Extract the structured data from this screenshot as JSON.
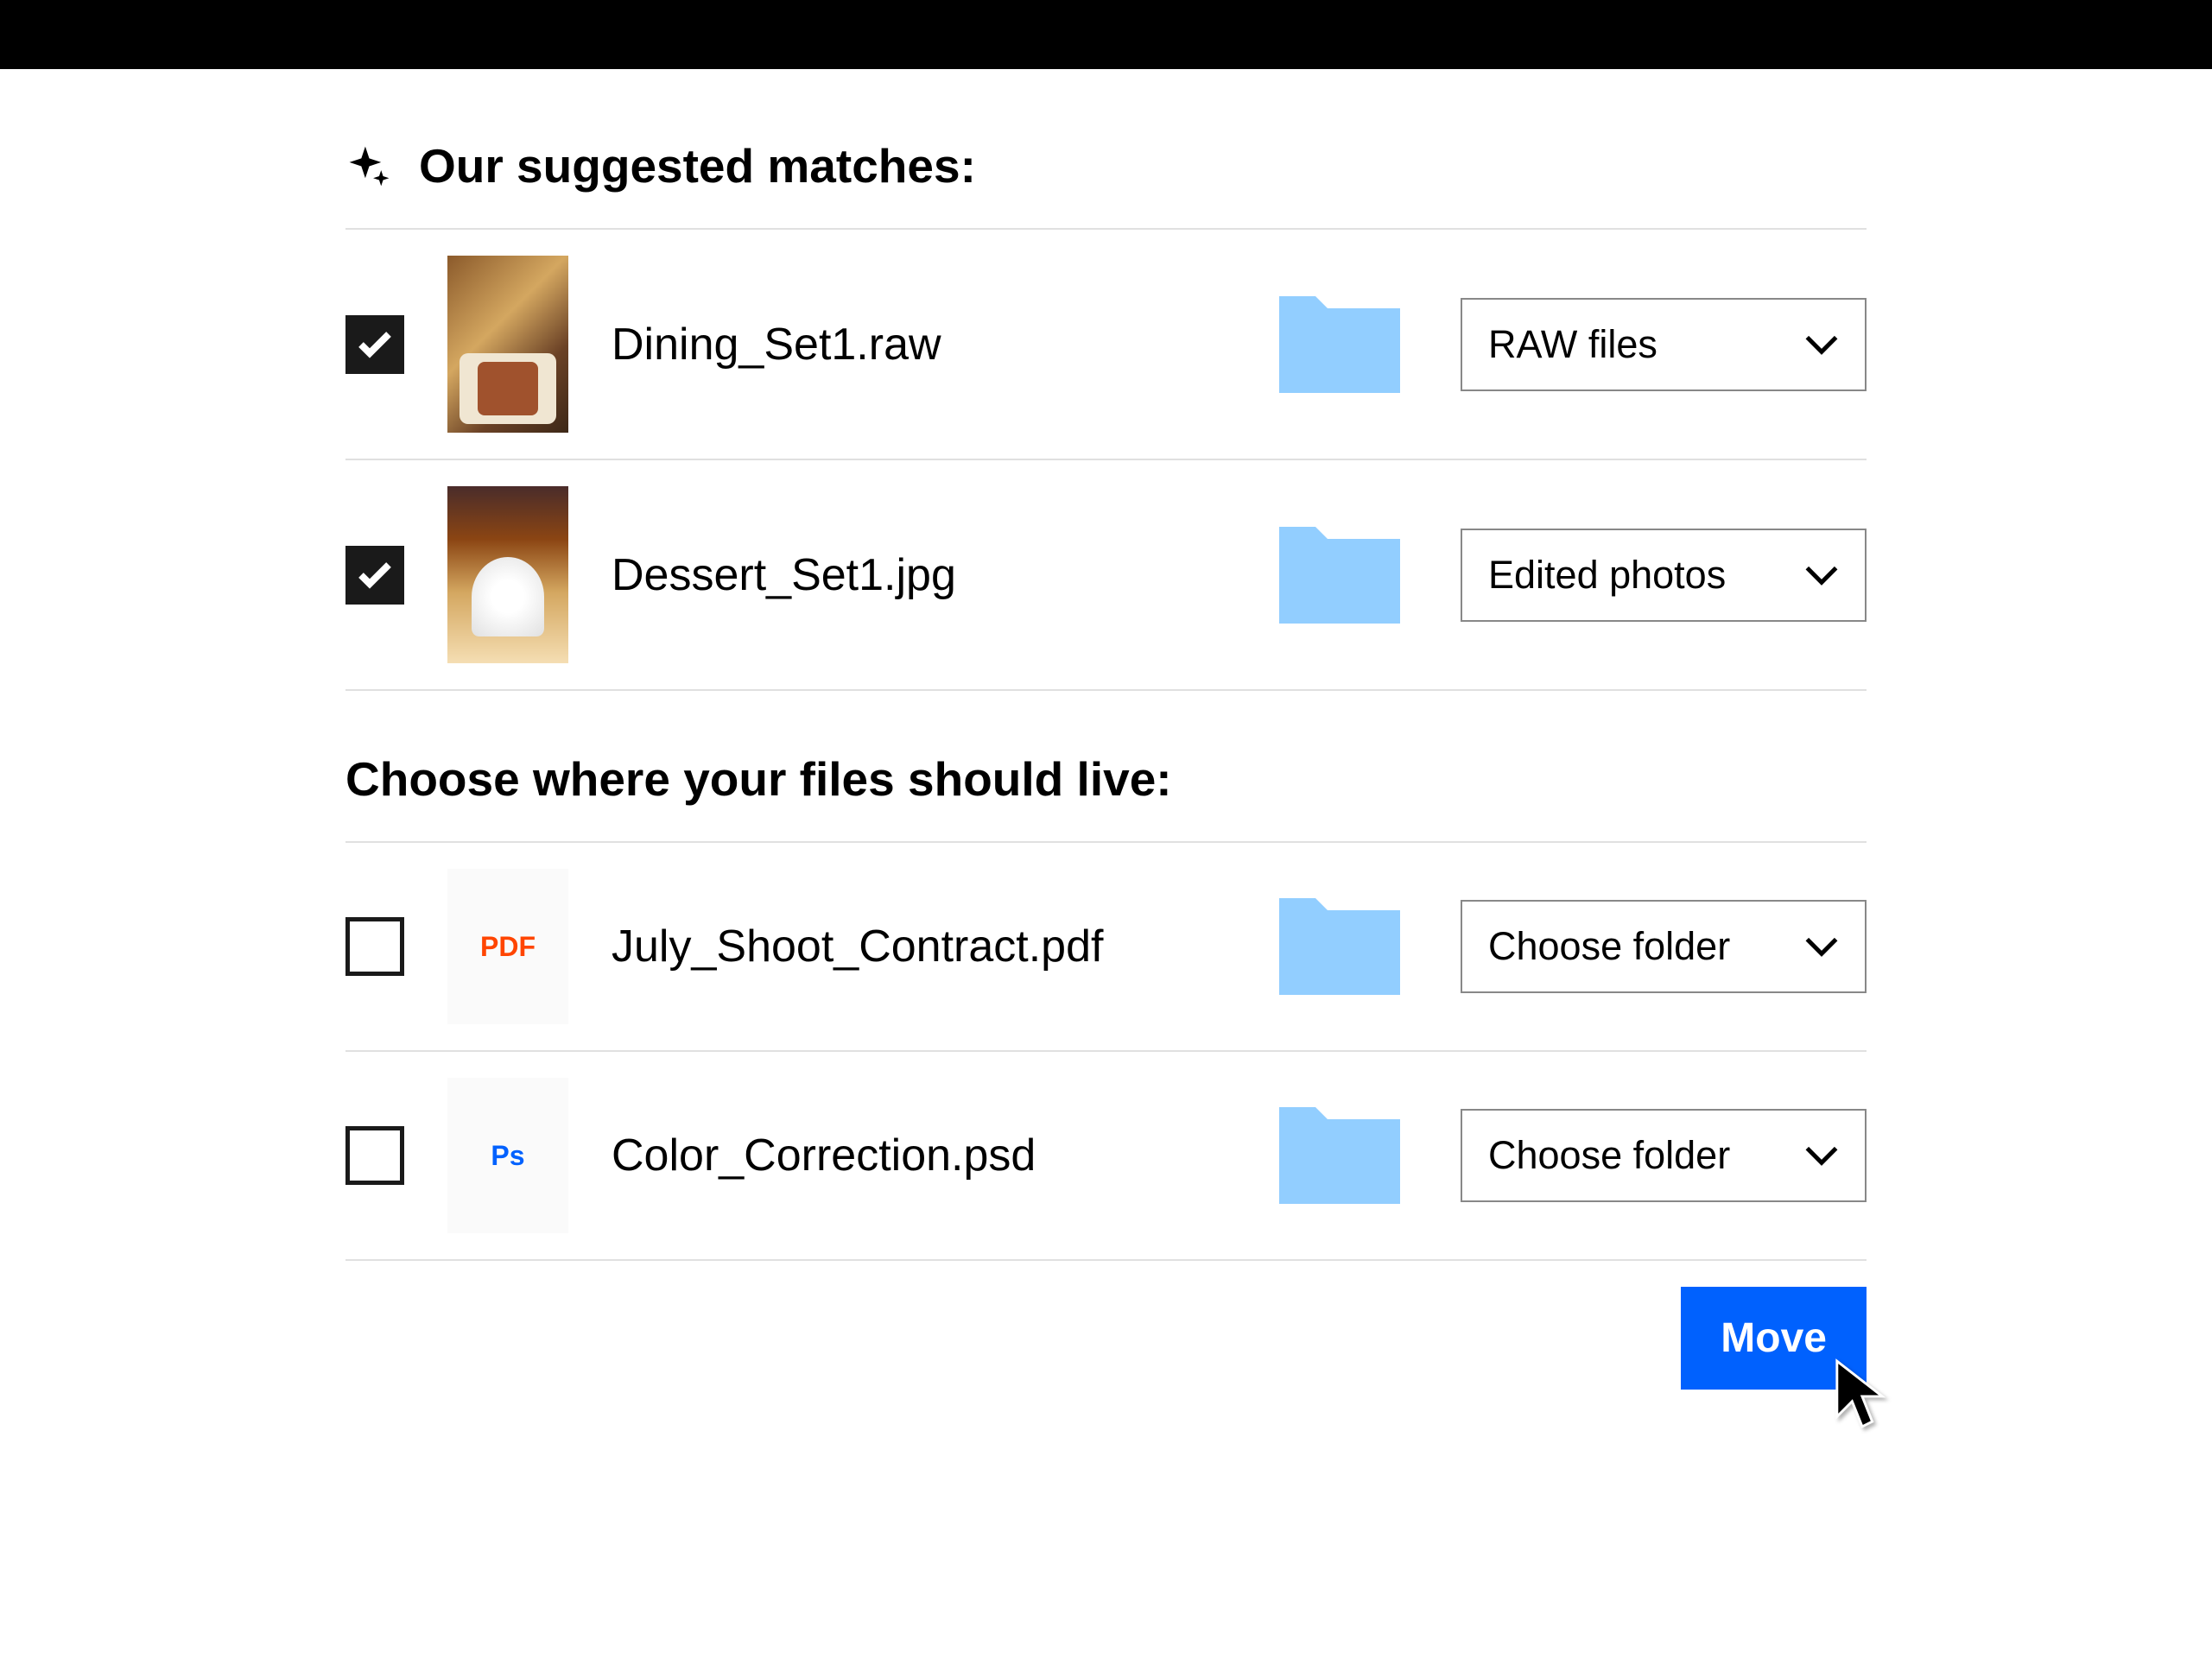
{
  "sections": {
    "suggested": {
      "title": "Our suggested matches:",
      "items": [
        {
          "filename": "Dining_Set1.raw",
          "checked": true,
          "folder_selected": "RAW files",
          "thumbnail_type": "photo"
        },
        {
          "filename": "Dessert_Set1.jpg",
          "checked": true,
          "folder_selected": "Edited photos",
          "thumbnail_type": "photo"
        }
      ]
    },
    "choose": {
      "title": "Choose where your files should live:",
      "items": [
        {
          "filename": "July_Shoot_Contract.pdf",
          "checked": false,
          "folder_selected": "Choose folder",
          "file_type_label": "PDF"
        },
        {
          "filename": "Color_Correction.psd",
          "checked": false,
          "folder_selected": "Choose folder",
          "file_type_label": "Ps"
        }
      ]
    }
  },
  "actions": {
    "move_button": "Move"
  }
}
